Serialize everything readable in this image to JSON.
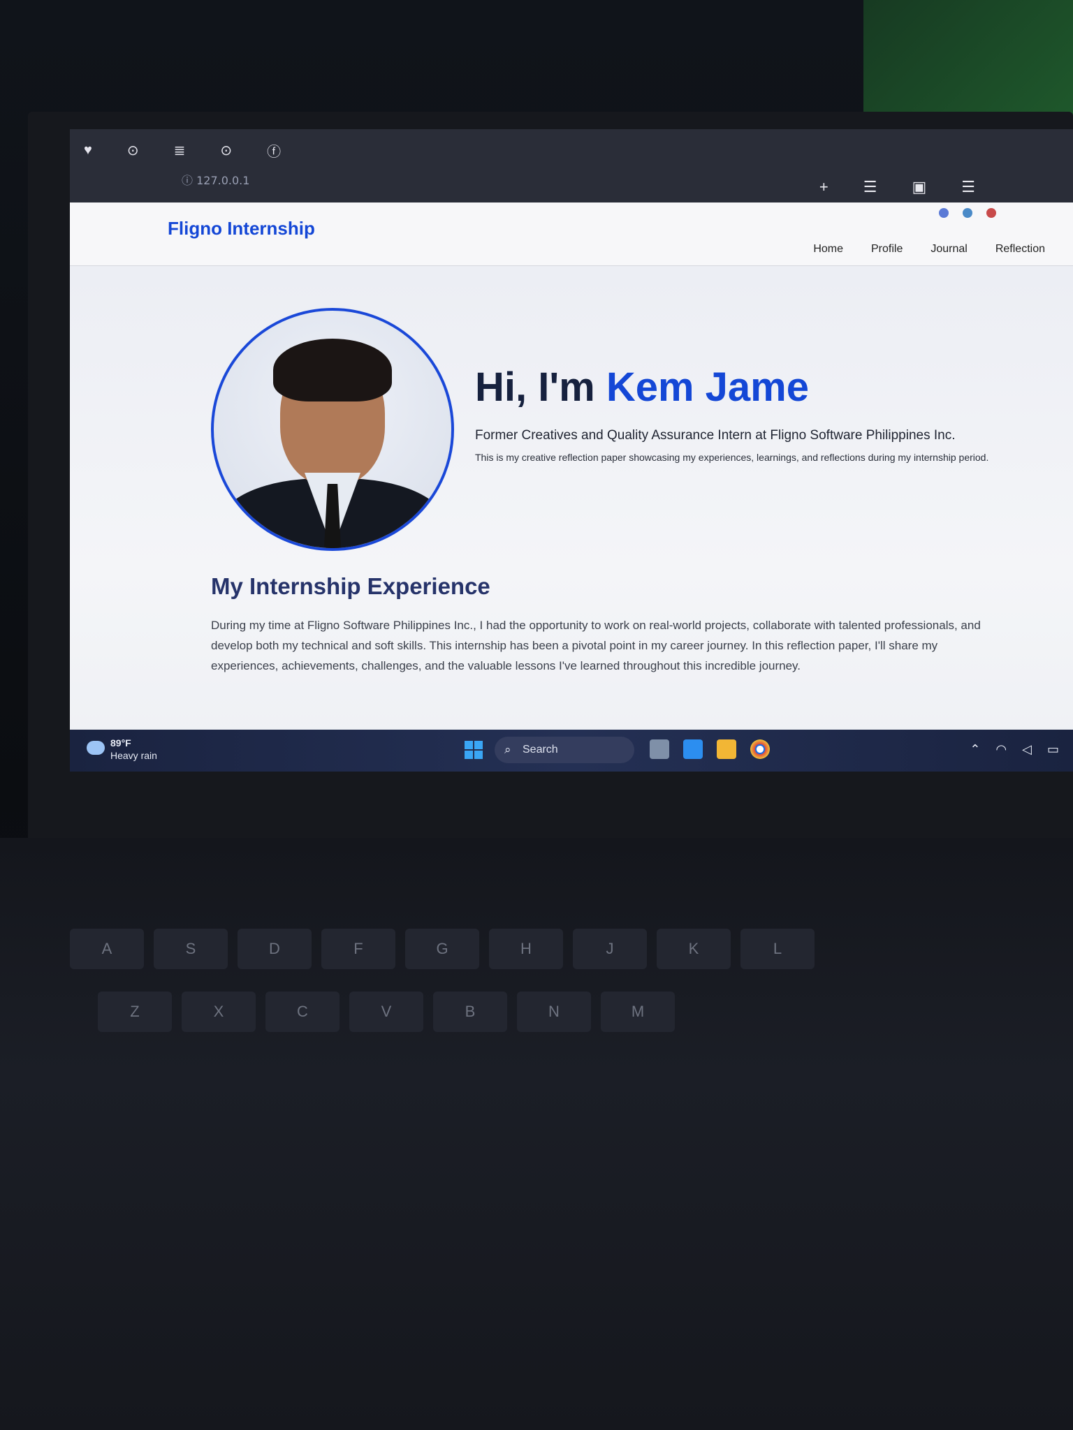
{
  "browser": {
    "address": "127.0.0.1"
  },
  "site": {
    "brand": "Fligno Internship",
    "nav": [
      {
        "label": "Home"
      },
      {
        "label": "Profile"
      },
      {
        "label": "Journal"
      },
      {
        "label": "Reflection"
      }
    ]
  },
  "hero": {
    "greeting": "Hi, I'm",
    "name": "Kem Jame",
    "subtitle": "Former Creatives and Quality Assurance Intern at Fligno Software Philippines Inc.",
    "description": "This is my creative reflection paper showcasing my experiences, learnings, and reflections during my internship period."
  },
  "experience": {
    "title": "My Internship Experience",
    "body": "During my time at Fligno Software Philippines Inc., I had the opportunity to work on real-world projects, collaborate with talented professionals, and develop both my technical and soft skills. This internship has been a pivotal point in my career journey. In this reflection paper, I'll share my experiences, achievements, challenges, and the valuable lessons I've learned throughout this incredible journey."
  },
  "taskbar": {
    "temperature": "89°F",
    "weather": "Heavy rain",
    "search_placeholder": "Search"
  },
  "keyboard": {
    "row1": [
      "A",
      "S",
      "D",
      "F",
      "G",
      "H",
      "J",
      "K",
      "L"
    ],
    "row2": [
      "Z",
      "X",
      "C",
      "V",
      "B",
      "N",
      "M"
    ]
  },
  "colors": {
    "accent": "#1447d6",
    "heading": "#26336a",
    "taskbar": "#1a2340"
  }
}
